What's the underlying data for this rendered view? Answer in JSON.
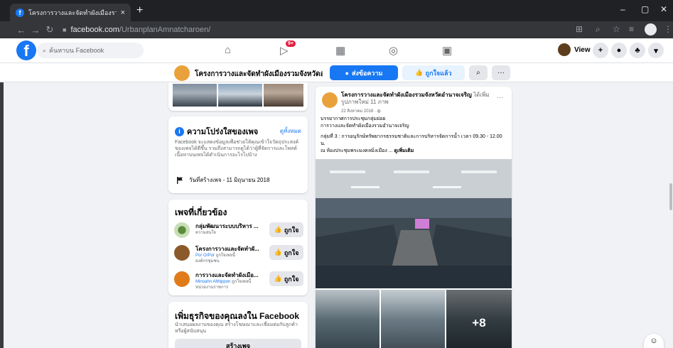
{
  "browser": {
    "tab_title": "โครงการวางและจัดทำผังเมืองรวมจังหวัดอำ",
    "tab_close": "×",
    "new_tab": "+",
    "url_domain": "facebook.com",
    "url_path": "/UrbanplanAmnatcharoen/",
    "minimize": "–",
    "maximize": "▢",
    "close": "✕"
  },
  "fb": {
    "logo": "f",
    "search_placeholder": "ค้นหาบน Facebook",
    "notif_count": "9+",
    "account_label": "View"
  },
  "page_header": {
    "name": "โครงการวางและจัดทำผังเมืองรวมจังหวัดอำน...",
    "send_message": "ส่งข้อความ",
    "liked": "ถูกใจแล้ว"
  },
  "transparency": {
    "title": "ความโปร่งใสของเพจ",
    "see_all": "ดูทั้งหมด",
    "description": "Facebook จะแสดงข้อมูลเพื่อช่วยให้คุณเข้าใจวัตถุประสงค์ของเพจได้ดีขึ้น รวมถึงสามารถดูได้ว่าผู้ที่จัดการและโพสต์เนื้อหาบนเพจได้ดำเนินการอะไรไปบ้าง",
    "created": "วันที่สร้างเพจ - 11 มิถุนายน 2018"
  },
  "related": {
    "title": "เพจที่เกี่ยวข้อง",
    "like_label": "ถูกใจ",
    "items": [
      {
        "name": "กลุ่มพัฒนาระบบบริหาร ...",
        "sub1": "ความสนใจ",
        "sub1_link": "",
        "sub2": ""
      },
      {
        "name": "โครงการวางและจัดทำผั...",
        "sub1": "ถูกใจเพจนี้",
        "sub1_link": "Por OrPor",
        "sub2": "องค์กรชุมชน"
      },
      {
        "name": "การวางและจัดทำผังเมือ...",
        "sub1": "ถูกใจเพจนี้",
        "sub1_link": "Minoahn Althippon",
        "sub2": "หน่วยงานราชการ"
      }
    ]
  },
  "business": {
    "title": "เพิ่มธุรกิจของคุณลงใน Facebook",
    "desc": "นำเสนอผลงานของคุณ สร้างโฆษณาและเชื่อมต่อกับลูกค้าหรือผู้สนับสนุน",
    "create": "สร้างเพจ"
  },
  "post": {
    "author": "โครงการวางและจัดทำผังเมืองรวมจังหวัดอำนาจเจริญ",
    "action": "ได้เพิ่มรูปภาพใหม่ 11 ภาพ",
    "time": "22 สิงหาคม 2018 · ",
    "more": "···",
    "line1": "บรรยากาศการประชุมกลุ่มย่อย",
    "line2": "การวางและจัดทำผังเมืองรวมอำนาจเจริญ",
    "line3": "กลุ่มที่ 3 : การอนุรักษ์ทรัพยากรธรรมชาติและการบริหารจัดการน้ำ เวลา 09.30 - 12.00 น.",
    "line4": "ณ ห้องประชุมพระมงคลมิ่งเมือง ...",
    "see_more": "ดูเพิ่มเติม",
    "extra_photos": "+8"
  }
}
